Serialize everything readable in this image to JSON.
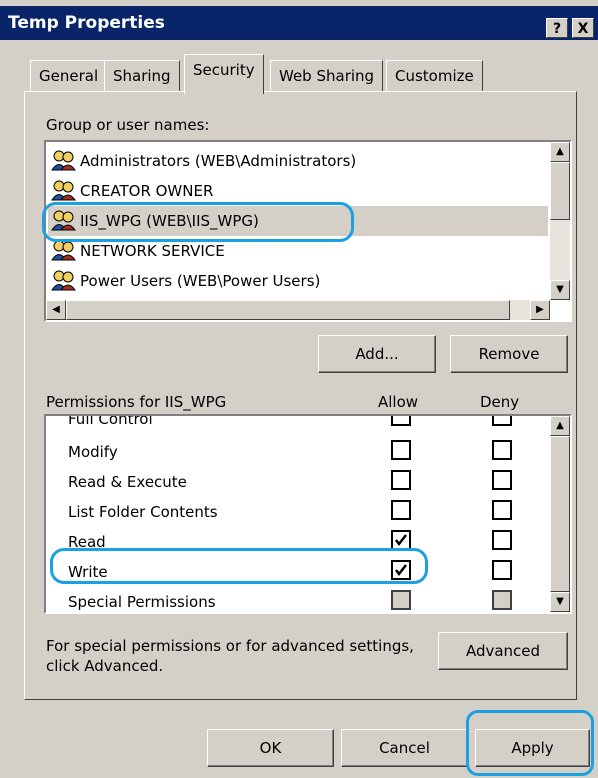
{
  "window": {
    "title": "Temp Properties",
    "help_button": "?",
    "close_button": "X"
  },
  "tabs": [
    {
      "label": "General"
    },
    {
      "label": "Sharing"
    },
    {
      "label": "Security",
      "active": true
    },
    {
      "label": "Web Sharing"
    },
    {
      "label": "Customize"
    }
  ],
  "groups": {
    "label": "Group or user names:",
    "items": [
      {
        "label": "Administrators (WEB\\Administrators)"
      },
      {
        "label": "CREATOR OWNER"
      },
      {
        "label": "IIS_WPG (WEB\\IIS_WPG)",
        "selected": true
      },
      {
        "label": "NETWORK SERVICE"
      },
      {
        "label": "Power Users (WEB\\Power Users)"
      }
    ],
    "add_button": "Add...",
    "remove_button": "Remove"
  },
  "permissions": {
    "label": "Permissions for IIS_WPG",
    "allow_header": "Allow",
    "deny_header": "Deny",
    "rows": [
      {
        "label": "Full Control",
        "allow": false,
        "deny": false
      },
      {
        "label": "Modify",
        "allow": false,
        "deny": false
      },
      {
        "label": "Read & Execute",
        "allow": false,
        "deny": false
      },
      {
        "label": "List Folder Contents",
        "allow": false,
        "deny": false
      },
      {
        "label": "Read",
        "allow": true,
        "deny": false
      },
      {
        "label": "Write",
        "allow": true,
        "deny": false
      },
      {
        "label": "Special Permissions",
        "allow": false,
        "deny": false,
        "disabled": true
      }
    ]
  },
  "advanced": {
    "text": "For special permissions or for advanced settings, click Advanced.",
    "button": "Advanced"
  },
  "footer": {
    "ok": "OK",
    "cancel": "Cancel",
    "apply": "Apply"
  },
  "colors": {
    "titlebar": "#0a246a",
    "dialog": "#d4d0c8",
    "annotation": "#1ba1e2"
  }
}
